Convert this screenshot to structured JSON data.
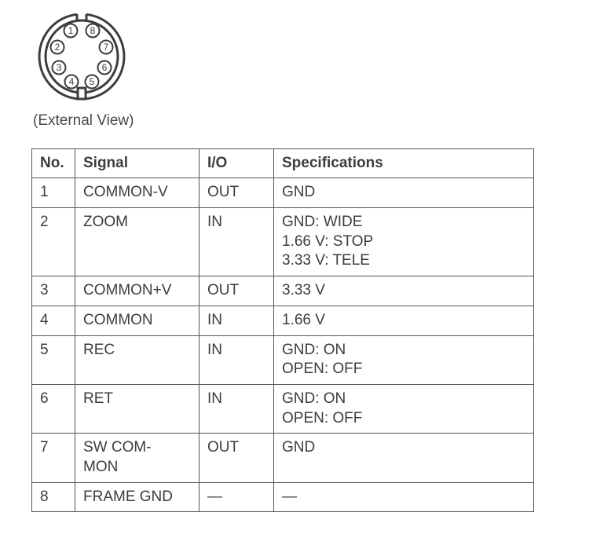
{
  "connector": {
    "caption": "(External View)",
    "pins": [
      "1",
      "2",
      "3",
      "4",
      "5",
      "6",
      "7",
      "8"
    ]
  },
  "table": {
    "headers": {
      "no": "No.",
      "signal": "Signal",
      "io": "I/O",
      "spec": "Specifications"
    },
    "rows": [
      {
        "no": "1",
        "signal": "COMMON-V",
        "io": "OUT",
        "spec": [
          "GND"
        ]
      },
      {
        "no": "2",
        "signal": "ZOOM",
        "io": "IN",
        "spec": [
          "GND: WIDE",
          "1.66 V: STOP",
          "3.33 V: TELE"
        ]
      },
      {
        "no": "3",
        "signal": "COMMON+V",
        "io": "OUT",
        "spec": [
          "3.33 V"
        ]
      },
      {
        "no": "4",
        "signal": "COMMON",
        "io": "IN",
        "spec": [
          "1.66 V"
        ]
      },
      {
        "no": "5",
        "signal": "REC",
        "io": "IN",
        "spec": [
          "GND: ON",
          "OPEN: OFF"
        ]
      },
      {
        "no": "6",
        "signal": "RET",
        "io": "IN",
        "spec": [
          "GND: ON",
          "OPEN: OFF"
        ]
      },
      {
        "no": "7",
        "signal": "SW COM-\nMON",
        "io": "OUT",
        "spec": [
          "GND"
        ]
      },
      {
        "no": "8",
        "signal": "FRAME GND",
        "io": "—",
        "spec": [
          "—"
        ]
      }
    ]
  }
}
